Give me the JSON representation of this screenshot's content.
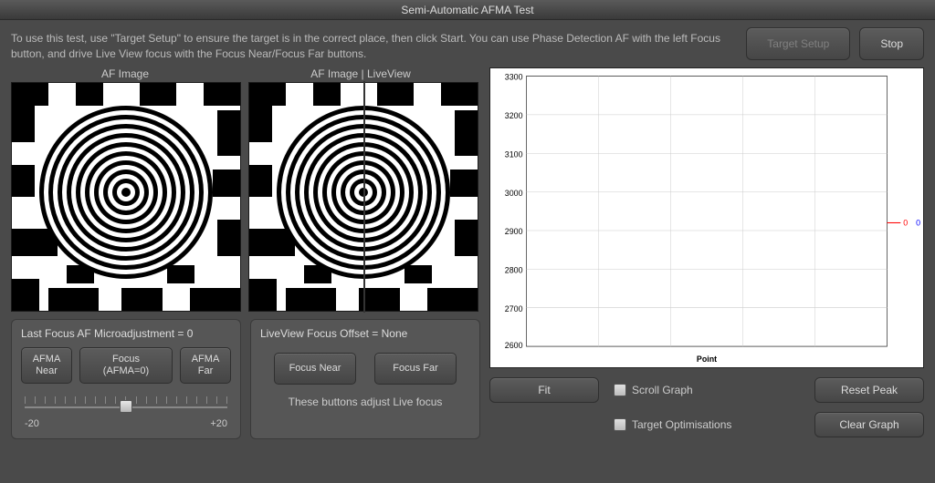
{
  "title": "Semi-Automatic AFMA Test",
  "instructions": "To use this test, use \"Target Setup\" to ensure the target is in the correct place, then click Start.  You can use Phase Detection AF with the left Focus button, and drive Live View focus with the Focus Near/Focus Far buttons.",
  "buttons": {
    "target_setup": "Target Setup",
    "stop": "Stop",
    "fit": "Fit",
    "reset_peak": "Reset Peak",
    "clear_graph": "Clear Graph",
    "afma_near": "AFMA\nNear",
    "afma_focus": "Focus\n(AFMA=0)",
    "afma_far": "AFMA\nFar",
    "focus_near": "Focus Near",
    "focus_far": "Focus Far"
  },
  "labels": {
    "af_image": "AF Image",
    "split": "AF Image    |    LiveView",
    "last_focus": "Last Focus AF Microadjustment = 0",
    "lv_offset": "LiveView Focus Offset = None",
    "lv_caption": "These buttons adjust Live focus",
    "slider_min": "-20",
    "slider_max": "+20",
    "scroll_graph": "Scroll Graph",
    "target_opt": "Target Optimisations"
  },
  "slider": {
    "min": -20,
    "max": 20,
    "value": 0
  },
  "chart_data": {
    "type": "line",
    "title": "",
    "xlabel": "Point",
    "ylabel": "",
    "y_ticks": [
      2600,
      2700,
      2800,
      2900,
      3000,
      3100,
      3200,
      3300
    ],
    "ylim": [
      2600,
      3300
    ],
    "series": [
      {
        "name": "0",
        "color": "#ff0000",
        "values": []
      },
      {
        "name": "0",
        "color": "#0000ff",
        "values": []
      }
    ],
    "legend_position": "right",
    "grid": true
  }
}
